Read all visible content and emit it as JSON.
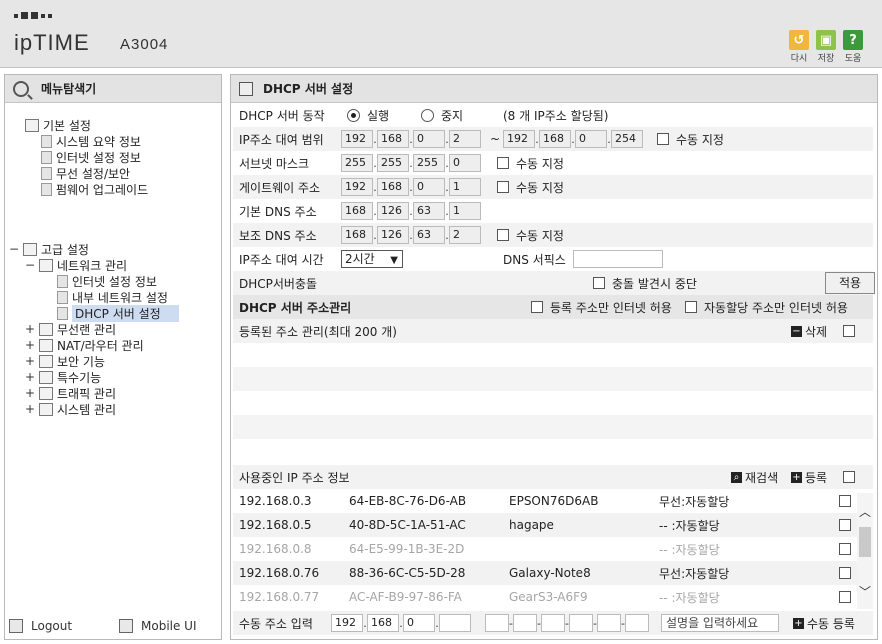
{
  "header": {
    "brand": "ipTIME",
    "model": "A3004",
    "buttons": [
      {
        "label": "다시",
        "icon": "reload-icon",
        "color": "#f2b640"
      },
      {
        "label": "저장",
        "icon": "save-icon",
        "color": "#8fc24a"
      },
      {
        "label": "도움",
        "icon": "help-icon",
        "color": "#3b9b3b"
      }
    ]
  },
  "sidebar": {
    "title": "메뉴탐색기",
    "basic": {
      "label": "기본 설정",
      "items": [
        "시스템 요약 정보",
        "인터넷 설정 정보",
        "무선 설정/보안",
        "펌웨어 업그레이드"
      ]
    },
    "advanced": {
      "toggle": "−",
      "label": "고급 설정",
      "network": {
        "toggle": "−",
        "label": "네트워크 관리",
        "items": [
          "인터넷 설정 정보",
          "내부 네트워크 설정",
          "DHCP 서버 설정"
        ]
      },
      "others": [
        {
          "toggle": "+",
          "label": "무선랜 관리"
        },
        {
          "toggle": "+",
          "label": "NAT/라우터 관리"
        },
        {
          "toggle": "+",
          "label": "보안 기능"
        },
        {
          "toggle": "+",
          "label": "특수기능"
        },
        {
          "toggle": "+",
          "label": "트래픽 관리"
        },
        {
          "toggle": "+",
          "label": "시스템 관리"
        }
      ]
    },
    "footer": {
      "logout": "Logout",
      "mobile": "Mobile UI"
    }
  },
  "main": {
    "title": "DHCP 서버 설정",
    "dhcp_mode": {
      "label": "DHCP 서버 동작",
      "run": "실행",
      "stop": "중지",
      "note": "(8 개 IP주소 할당됨)"
    },
    "lease_range": {
      "label": "IP주소 대여 범위",
      "start": [
        "192",
        "168",
        "0",
        "2"
      ],
      "sep": "~",
      "end": [
        "192",
        "168",
        "0",
        "254"
      ],
      "manual": "수동 지정"
    },
    "subnet": {
      "label": "서브넷 마스크",
      "value": [
        "255",
        "255",
        "255",
        "0"
      ],
      "manual": "수동 지정"
    },
    "gateway": {
      "label": "게이트웨이 주소",
      "value": [
        "192",
        "168",
        "0",
        "1"
      ],
      "manual": "수동 지정"
    },
    "dns1": {
      "label": "기본 DNS 주소",
      "value": [
        "168",
        "126",
        "63",
        "1"
      ]
    },
    "dns2": {
      "label": "보조 DNS 주소",
      "value": [
        "168",
        "126",
        "63",
        "2"
      ],
      "manual": "수동 지정"
    },
    "lease_time": {
      "label": "IP주소 대여 시간",
      "value": "2시간",
      "dns_suffix_label": "DNS 서픽스",
      "dns_suffix_value": ""
    },
    "conflict": {
      "label": "DHCP서버충돌",
      "check_label": "충돌 발견시 중단",
      "apply": "적용"
    },
    "addr_mgmt": {
      "title": "DHCP 서버 주소관리",
      "opt1": "등록 주소만 인터넷 허용",
      "opt2": "자동할당 주소만 인터넷 허용"
    },
    "registered": {
      "label": "등록된 주소 관리(최대 200 개)",
      "delete": "삭제"
    },
    "in_use": {
      "label": "사용중인 IP 주소 정보",
      "rescan": "재검색",
      "register": "등록",
      "rows": [
        {
          "ip": "192.168.0.3",
          "mac": "64-EB-8C-76-D6-AB",
          "name": "EPSON76D6AB",
          "type": "무선:자동할당",
          "dim": false
        },
        {
          "ip": "192.168.0.5",
          "mac": "40-8D-5C-1A-51-AC",
          "name": "hagape",
          "type": "-- :자동할당",
          "dim": false
        },
        {
          "ip": "192.168.0.8",
          "mac": "64-E5-99-1B-3E-2D",
          "name": "",
          "type": "-- :자동할당",
          "dim": true
        },
        {
          "ip": "192.168.0.76",
          "mac": "88-36-6C-C5-5D-28",
          "name": "Galaxy-Note8",
          "type": "무선:자동할당",
          "dim": false
        },
        {
          "ip": "192.168.0.77",
          "mac": "AC-AF-B9-97-86-FA",
          "name": "GearS3-A6F9",
          "type": "-- :자동할당",
          "dim": true
        }
      ]
    },
    "manual_entry": {
      "label": "수동 주소 입력",
      "ip": [
        "192",
        "168",
        "0",
        ""
      ],
      "desc_placeholder": "설명을 입력하세요",
      "register": "수동 등록"
    }
  }
}
